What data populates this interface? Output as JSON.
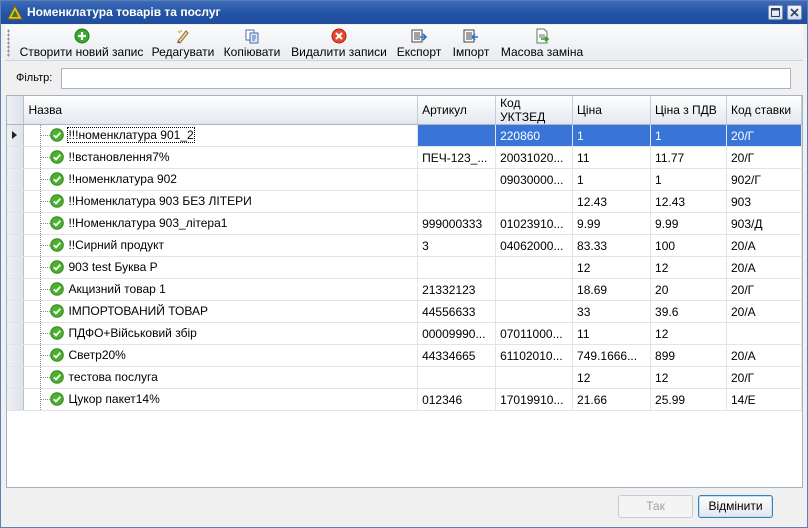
{
  "window": {
    "title": "Номенклатура товарів та послуг"
  },
  "toolbar": {
    "buttons": [
      {
        "label": "Створити новий запис",
        "icon": "add-icon"
      },
      {
        "label": "Редагувати",
        "icon": "edit-icon"
      },
      {
        "label": "Копіювати",
        "icon": "copy-icon"
      },
      {
        "label": "Видалити записи",
        "icon": "delete-icon"
      },
      {
        "label": "Експорт",
        "icon": "export-icon"
      },
      {
        "label": "Імпорт",
        "icon": "import-icon"
      },
      {
        "label": "Масова заміна",
        "icon": "bulk-replace-icon"
      }
    ]
  },
  "filter": {
    "label": "Фільтр:",
    "value": ""
  },
  "grid": {
    "columns": [
      "Назва",
      "Артикул",
      "Код УКТЗЕД",
      "Ціна",
      "Ціна з ПДВ",
      "Код ставки"
    ],
    "rows": [
      {
        "name": "!!!номенклатура 901_2",
        "article": "",
        "code": "220860",
        "price": "1",
        "price_vat": "1",
        "rate": "20/Г",
        "selected": true
      },
      {
        "name": "!!встановлення7%",
        "article": "ПЕЧ-123_...",
        "code": "20031020...",
        "price": "11",
        "price_vat": "11.77",
        "rate": "20/Г"
      },
      {
        "name": "!!номенклатура 902",
        "article": "",
        "code": "09030000...",
        "price": "1",
        "price_vat": "1",
        "rate": "902/Г"
      },
      {
        "name": "!!Номенклатура 903 БЕЗ ЛІТЕРИ",
        "article": "",
        "code": "",
        "price": "12.43",
        "price_vat": "12.43",
        "rate": "903"
      },
      {
        "name": "!!Номенклатура 903_літера1",
        "article": "999000333",
        "code": "01023910...",
        "price": "9.99",
        "price_vat": "9.99",
        "rate": "903/Д"
      },
      {
        "name": "!!Сирний продукт",
        "article": "3",
        "code": "04062000...",
        "price": "83.33",
        "price_vat": "100",
        "rate": "20/А"
      },
      {
        "name": "903 test Буква Р",
        "article": "",
        "code": "",
        "price": "12",
        "price_vat": "12",
        "rate": "20/А"
      },
      {
        "name": "Акцизний товар 1",
        "article": "21332123",
        "code": "",
        "price": "18.69",
        "price_vat": "20",
        "rate": "20/Г"
      },
      {
        "name": "ІМПОРТОВАНИЙ ТОВАР",
        "article": "44556633",
        "code": "",
        "price": "33",
        "price_vat": "39.6",
        "rate": "20/А"
      },
      {
        "name": "ПДФО+Військовий збір",
        "article": "00009990...",
        "code": "07011000...",
        "price": "11",
        "price_vat": "12",
        "rate": ""
      },
      {
        "name": "Светр20%",
        "article": "44334665",
        "code": "61102010...",
        "price": "749.1666...",
        "price_vat": "899",
        "rate": "20/А"
      },
      {
        "name": "тестова послуга",
        "article": "",
        "code": "",
        "price": "12",
        "price_vat": "12",
        "rate": "20/Г"
      },
      {
        "name": "Цукор пакет14%",
        "article": "012346",
        "code": "17019910...",
        "price": "21.66",
        "price_vat": "25.99",
        "rate": "14/Е"
      }
    ]
  },
  "footer": {
    "ok_label": "Так",
    "cancel_label": "Відмінити"
  },
  "colors": {
    "title_bar": "#2353a3",
    "selection": "#3875d7",
    "check_green": "#4caf2e"
  }
}
